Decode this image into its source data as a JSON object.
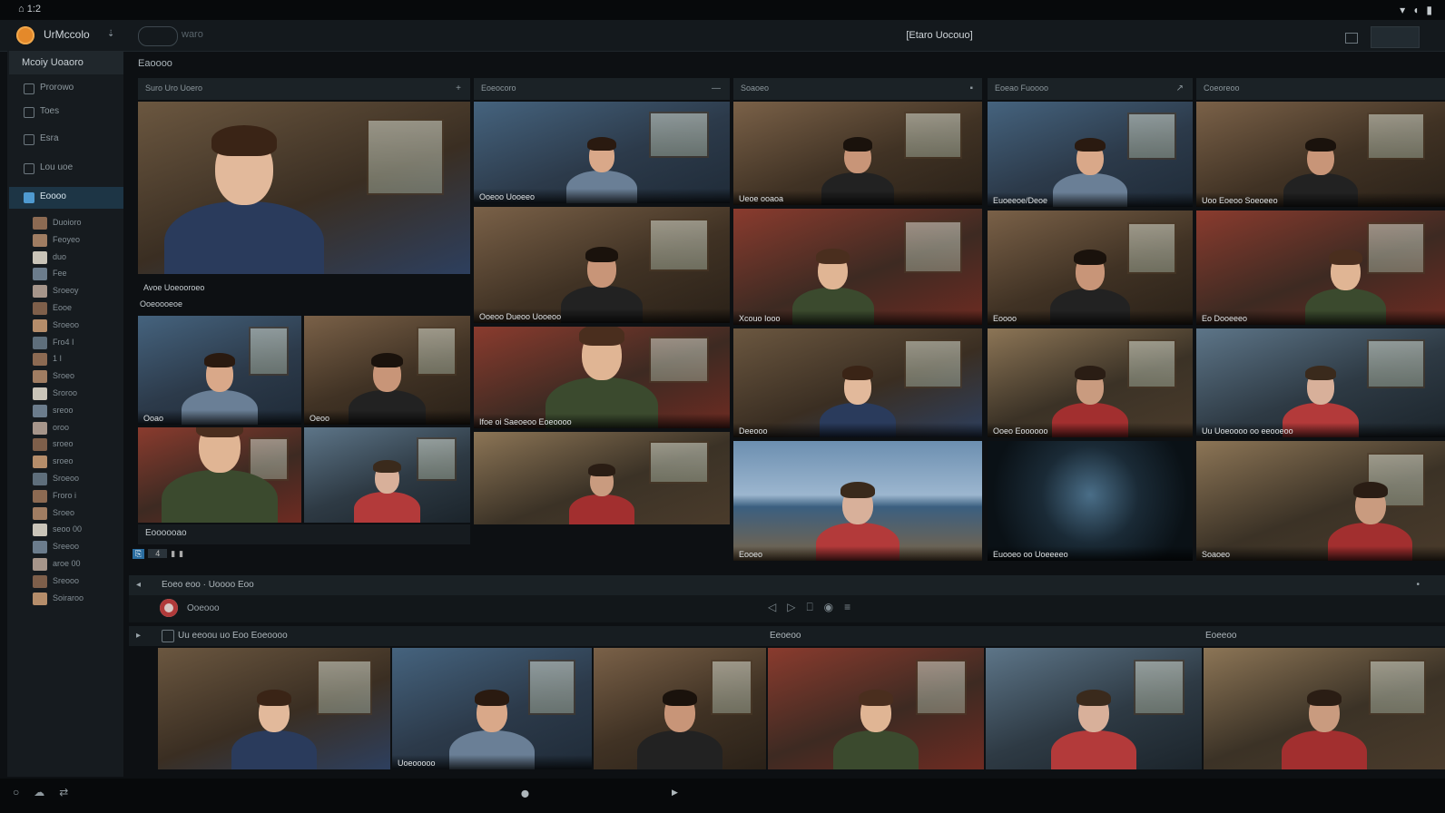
{
  "system": {
    "left_text": "⌂ 1:2",
    "right_icons": [
      "wifi-icon",
      "volume-icon",
      "battery-icon"
    ]
  },
  "titlebar": {
    "app_name": "UrMccolo",
    "logo_text": "waro",
    "window_title": "[Etaro Uocouo]"
  },
  "sidebar": {
    "header": "Mcoiy Uoaoro",
    "nav": [
      {
        "label": "Prorowo",
        "icon": "home-icon"
      },
      {
        "label": "Toes",
        "icon": "clock-icon"
      },
      {
        "label": "Esra",
        "icon": "people-icon"
      },
      {
        "label": "Lou uoe",
        "icon": "chat-icon"
      },
      {
        "label": "Eoooo",
        "icon": "video-icon",
        "active": true
      }
    ],
    "tree": [
      "Duoioro",
      "Feoyeo",
      "duo",
      "Fee",
      "Sroeoy",
      "Eooe",
      "Sroeoo",
      "Fro4 I",
      "1 I",
      "Sroeo",
      "Sroroo",
      "sreoo",
      "oroo",
      "sroeo",
      "sroeo",
      "Sroeoo",
      "Froro i",
      "Sroeo",
      "seoo 00",
      "Sreeoo",
      "aroe 00",
      "Sreooo",
      "Soiraroo"
    ]
  },
  "main": {
    "label": "Eaoooo",
    "columns": [
      {
        "title": "Suro Uro Uoero",
        "icon": "+"
      },
      {
        "title": "Eoeocoro",
        "icon": "—"
      },
      {
        "title": "Soaoeo",
        "icon": "▪"
      },
      {
        "title": "Eoeao Fuoooo",
        "icon": "↗"
      },
      {
        "title": "Coeoreoo",
        "icon": ""
      }
    ],
    "big_tile": {
      "caption": "Avoe Uoeooroeo",
      "sub": "Ooeoooeoe"
    },
    "c1_tiles": [
      "Ooao",
      "Oeoo",
      "",
      ""
    ],
    "c1_footer": "Eoooooao",
    "c2_tiles": [
      "Ooeoo Uooeeo",
      "Ooeoo Dueoo Uooeoo",
      "Ifoe oi Saeoeoo Eoeoooo",
      ""
    ],
    "c3_tiles": [
      "Ueoe ooaoa",
      "Xcouo Iooo",
      "Deeooo",
      "Eooeo"
    ],
    "c4_tiles": [
      "Euoeeoe/Deoe",
      "Eoooo",
      "Ooeo Eoooooo",
      "Euooeo oo Uoeeeeo"
    ],
    "c5_tiles": [
      "Uoo Eoeoo Soeoeeo",
      "Eo Dooeeeo",
      "Uu Uoeoooo oo eeooeoo",
      "Soaoeo"
    ],
    "page_controls": [
      "⎘",
      "4",
      "▮",
      "▮"
    ]
  },
  "controls": {
    "toolbar_label": "Eoeo eoo · Uoooo Eoo",
    "record_label": "Ooeooo",
    "center_icons": [
      "◁",
      "▷",
      "⎕",
      "◉",
      "≡"
    ],
    "strip_title": "Uu eeoou uo Eoo Eoeoooo",
    "strip_center_label": "Eeoeoo",
    "strip_right_label": "Eoeeoo",
    "strip_tiles": [
      "",
      "Uoeooooo",
      "",
      "",
      "",
      ""
    ]
  },
  "status": {
    "left_icons": [
      "power-icon",
      "cloud-icon",
      "sync-icon"
    ],
    "center": "⬤",
    "center2": "▶"
  }
}
